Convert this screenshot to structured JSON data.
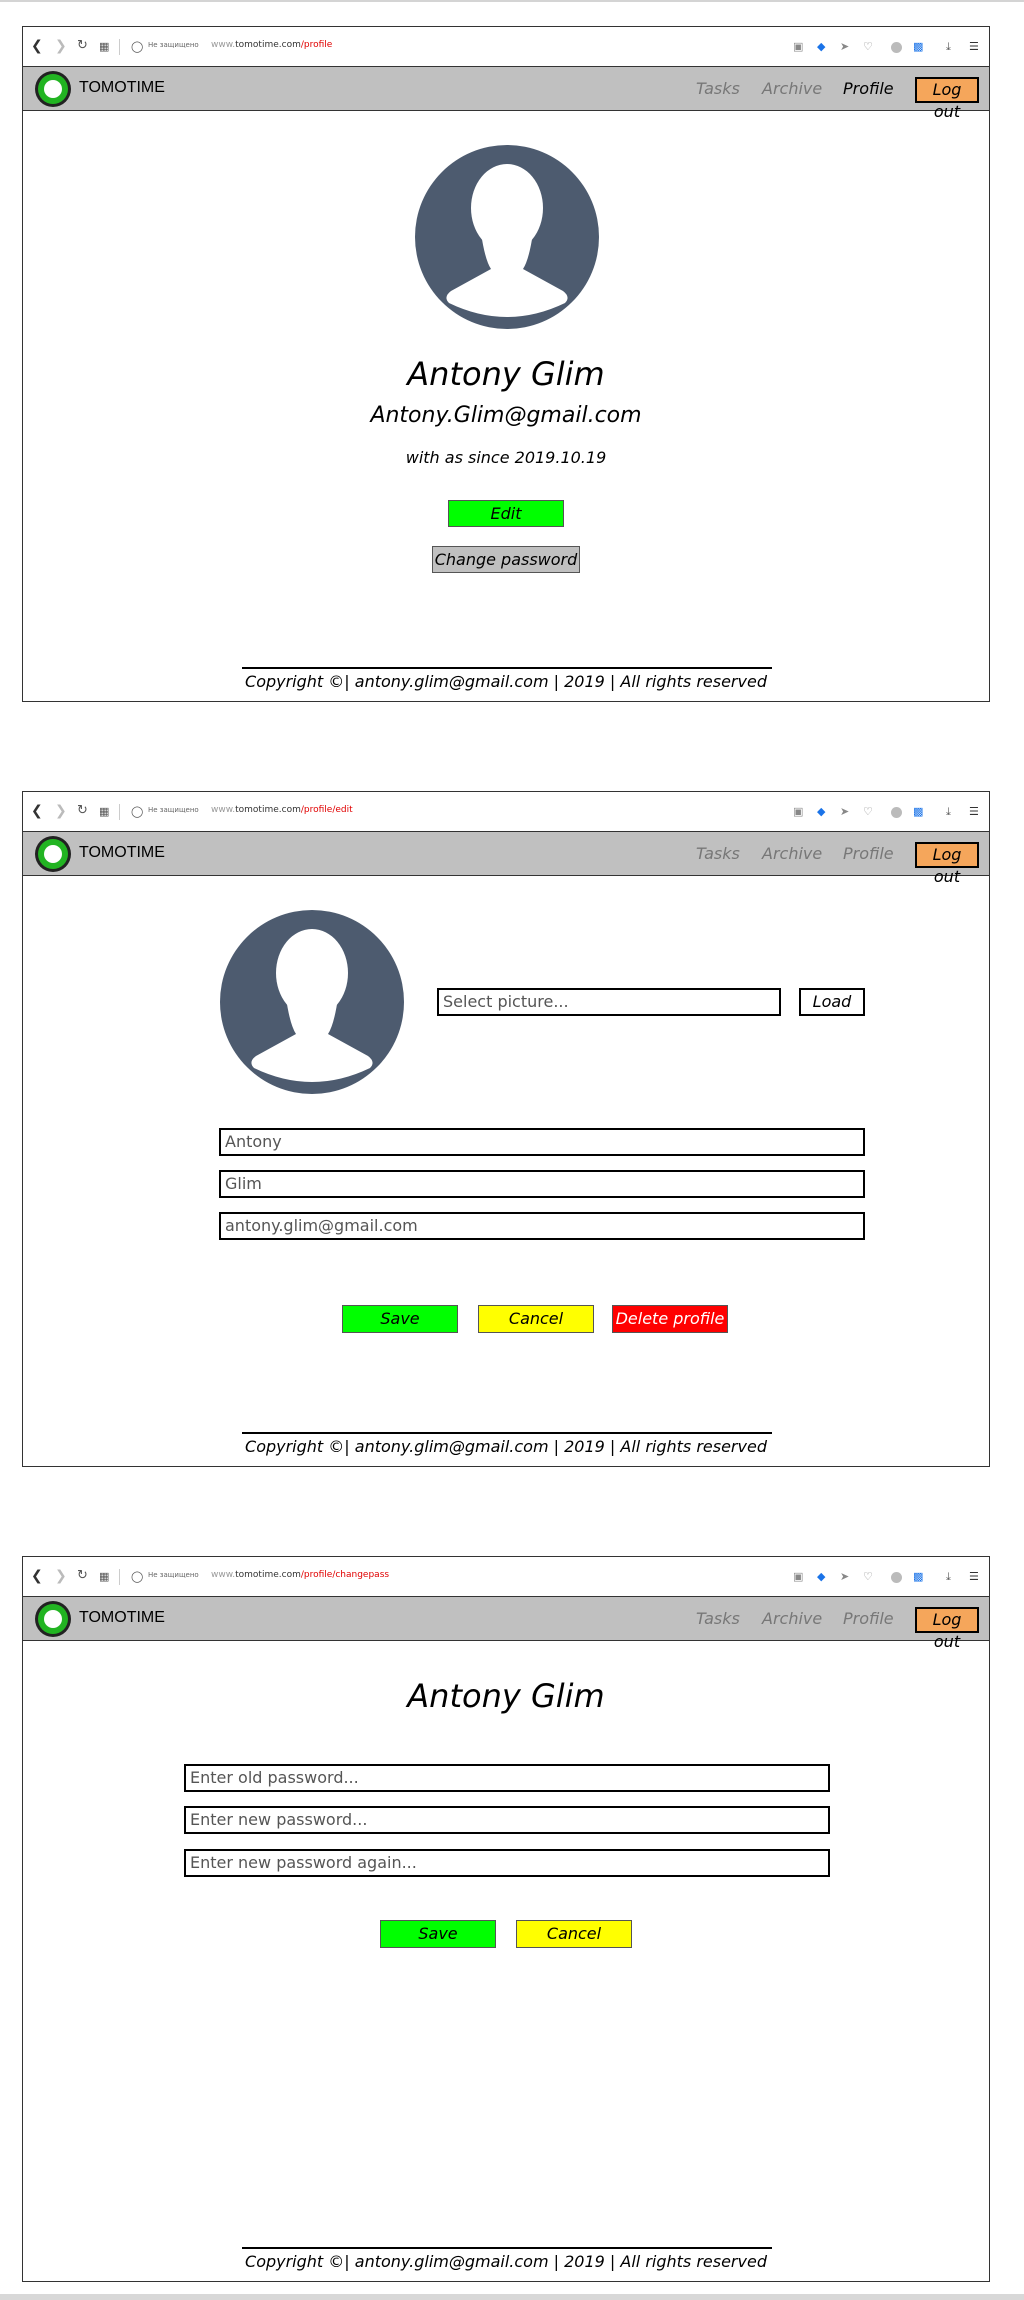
{
  "browser": {
    "insecure_label": "Не защищено",
    "url_www": "www.",
    "url_domain": "tomotime.com",
    "paths": {
      "profile": "/profile",
      "edit": "/profile/edit",
      "changepass": "/profile/changepass"
    }
  },
  "app": {
    "title": "TOMOTIME",
    "nav": {
      "tasks": "Tasks",
      "archive": "Archive",
      "profile": "Profile",
      "logout": "Log out"
    }
  },
  "profile_view": {
    "name": "Antony Glim",
    "email": "Antony.Glim@gmail.com",
    "since": "with as since 2019.10.19",
    "edit_button": "Edit",
    "change_password_button": "Change password"
  },
  "profile_edit": {
    "select_picture_placeholder": "Select picture...",
    "load_button": "Load",
    "first_name": "Antony",
    "last_name": "Glim",
    "email": "antony.glim@gmail.com",
    "save_button": "Save",
    "cancel_button": "Cancel",
    "delete_button": "Delete profile"
  },
  "change_password": {
    "name": "Antony Glim",
    "old_password_placeholder": "Enter old password...",
    "new_password_placeholder": "Enter new password...",
    "new_password_again_placeholder": "Enter new password again...",
    "save_button": "Save",
    "cancel_button": "Cancel"
  },
  "footer": {
    "text": "Copyright ©| antony.glim@gmail.com | 2019 | All rights reserved"
  },
  "colors": {
    "green": "#00ff00",
    "yellow": "#ffff00",
    "red": "#ff0000",
    "logout": "#f5a65b",
    "header": "#c0c0c0",
    "avatar": "#4d5b6f"
  }
}
